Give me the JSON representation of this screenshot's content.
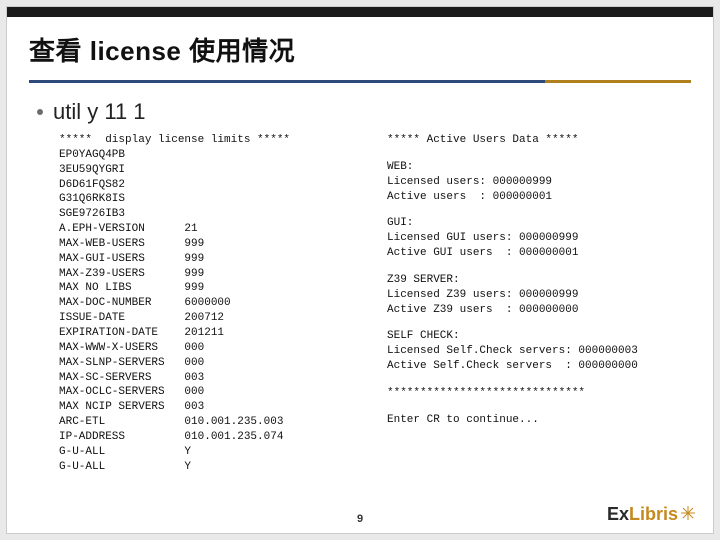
{
  "title": "查看 license 使用情况",
  "bullet": "util y 11 1",
  "left_header": "*****  display license limits *****",
  "left_codes": [
    "EP0YAGQ4PB",
    "3EU59QYGRI",
    "D6D61FQS82",
    "G31Q6RK8IS",
    "SGE9726IB3"
  ],
  "left_rows": [
    {
      "k": "A.EPH-VERSION",
      "v": "21"
    },
    {
      "k": "MAX-WEB-USERS",
      "v": "999"
    },
    {
      "k": "MAX-GUI-USERS",
      "v": "999"
    },
    {
      "k": "MAX-Z39-USERS",
      "v": "999"
    },
    {
      "k": "MAX NO LIBS",
      "v": "999"
    },
    {
      "k": "MAX-DOC-NUMBER",
      "v": "6000000"
    },
    {
      "k": "ISSUE-DATE",
      "v": "200712"
    },
    {
      "k": "EXPIRATION-DATE",
      "v": "201211"
    },
    {
      "k": "MAX-WWW-X-USERS",
      "v": "000"
    },
    {
      "k": "MAX-SLNP-SERVERS",
      "v": "000"
    },
    {
      "k": "MAX-SC-SERVERS",
      "v": "003"
    },
    {
      "k": "MAX-OCLC-SERVERS",
      "v": "000"
    },
    {
      "k": "MAX NCIP SERVERS",
      "v": "003"
    },
    {
      "k": "ARC-ETL",
      "v": "010.001.235.003"
    },
    {
      "k": "IP-ADDRESS",
      "v": "010.001.235.074"
    },
    {
      "k": "G-U-ALL",
      "v": "Y"
    },
    {
      "k": "G-U-ALL",
      "v": "Y"
    }
  ],
  "right": {
    "header": "***** Active Users Data *****",
    "sections": [
      {
        "title": "WEB:",
        "lines": [
          "Licensed users: 000000999",
          "Active users  : 000000001"
        ]
      },
      {
        "title": "GUI:",
        "lines": [
          "Licensed GUI users: 000000999",
          "Active GUI users  : 000000001"
        ]
      },
      {
        "title": "Z39 SERVER:",
        "lines": [
          "Licensed Z39 users: 000000999",
          "Active Z39 users  : 000000000"
        ]
      },
      {
        "title": "SELF CHECK:",
        "lines": [
          "Licensed Self.Check servers: 000000003",
          "Active Self.Check servers  : 000000000"
        ]
      }
    ],
    "stars": "******************************",
    "prompt": "Enter CR to continue..."
  },
  "footer": {
    "page": "9",
    "brand_ex": "Ex",
    "brand_l": "Libris"
  }
}
